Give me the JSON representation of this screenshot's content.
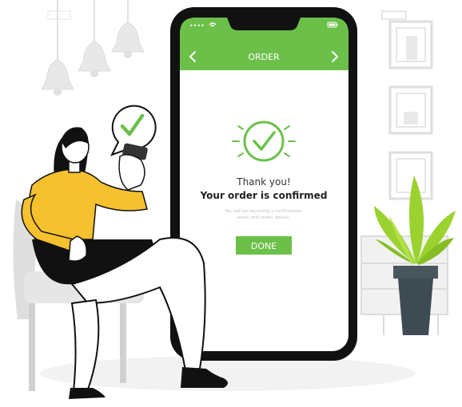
{
  "phone": {
    "status_bar": {
      "signal": "••••",
      "wifi_icon": "wifi-icon",
      "battery_icon": "battery-icon"
    },
    "nav": {
      "back_icon": "chevron-left-icon",
      "title": "ORDER",
      "forward_icon": "chevron-right-icon"
    },
    "confirmation": {
      "icon": "check-circle-icon",
      "thanks": "Thank you!",
      "heading": "Your order is confirmed",
      "note_line1": "You will be receiving a confirmation",
      "note_line2": "email with order details."
    },
    "done_button": "DONE"
  },
  "speech_bubble": {
    "icon": "checkmark-icon"
  },
  "colors": {
    "accent_green": "#6cc04a",
    "phone_body": "#111111",
    "shirt_yellow": "#f5c12e",
    "plant_green": "#9bd22f",
    "pot_gray": "#3f4b52",
    "line_gray": "#d9d9d9"
  }
}
